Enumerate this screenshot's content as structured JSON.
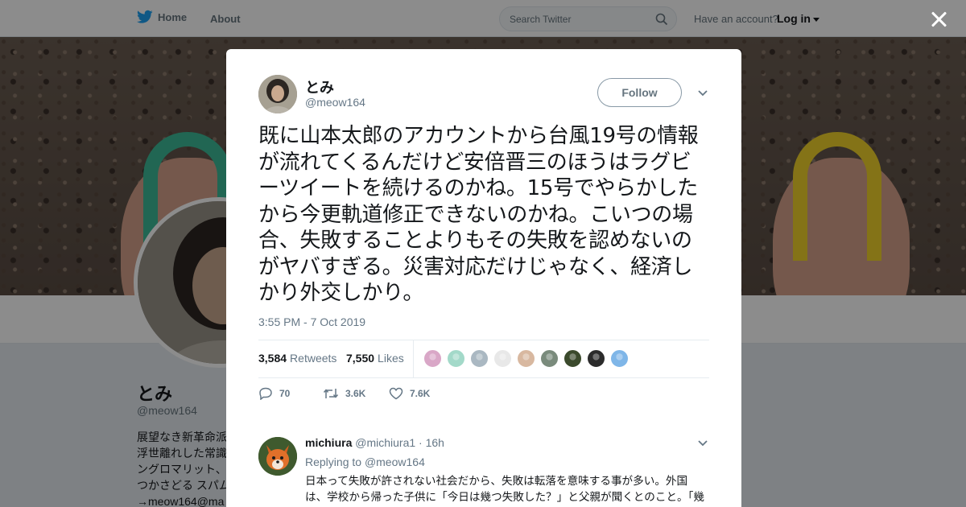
{
  "topbar": {
    "home_label": "Home",
    "about_label": "About",
    "search_placeholder": "Search Twitter",
    "have_account": "Have an account?",
    "login_label": "Log in"
  },
  "profile": {
    "name": "とみ",
    "handle": "@meow164",
    "bio": "展望なき新革命派\n浮世離れした常識\nングロマリット、\nつかさどる スパム\n→meow164@ma"
  },
  "tweet": {
    "author_name": "とみ",
    "author_handle": "@meow164",
    "follow_label": "Follow",
    "text": "既に山本太郎のアカウントから台風19号の情報が流れてくるんだけど安倍晋三のほうはラグビーツイートを続けるのかね。15号でやらかしたから今更軌道修正できないのかね。こいつの場合、失敗することよりもその失敗を認めないのがヤバすぎる。災害対応だけじゃなく、経済しかり外交しかり。",
    "timestamp": "3:55 PM - 7 Oct 2019",
    "retweets_count": "3,584",
    "retweets_label": "Retweets",
    "likes_count": "7,550",
    "likes_label": "Likes",
    "reply_count": "70",
    "retweet_action_count": "3.6K",
    "like_action_count": "7.6K",
    "retweeter_avatar_colors": [
      "#d9a7c7",
      "#a3d9c9",
      "#aab8c2",
      "#e8e8e8",
      "#d8b8a0",
      "#7a8b7c",
      "#3b4a2c",
      "#2b2b2b",
      "#7fb6e8"
    ]
  },
  "reply": {
    "name": "michiura",
    "handle": "@michiura1",
    "separator": "·",
    "time": "16h",
    "replying_prefix": "Replying to",
    "replying_to": "@meow164",
    "text": "日本って失敗が許されない社会だから、失敗は転落を意味する事が多い。外国は、学校から帰った子供に「今日は幾つ失敗した？」と父親が聞くとのこと。「幾"
  },
  "colors": {
    "accent": "#1da1f2",
    "secondary_text": "#657786",
    "primary_text": "#14171a"
  }
}
